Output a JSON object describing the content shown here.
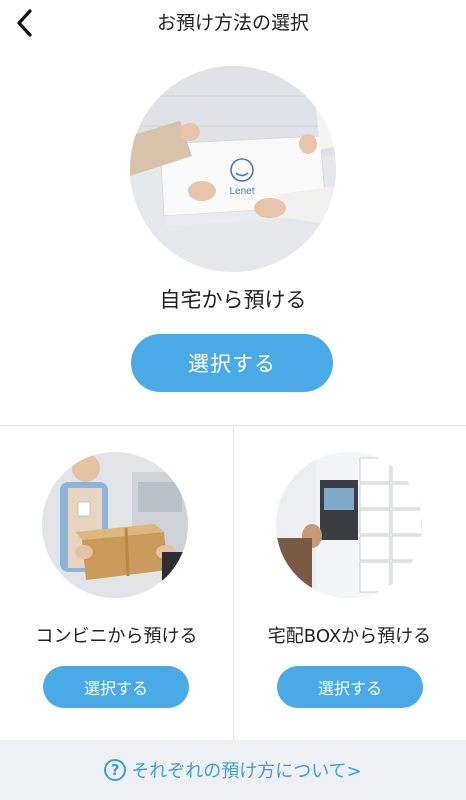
{
  "header": {
    "title": "お預け方法の選択",
    "back_icon": "chevron-left-icon"
  },
  "home": {
    "label": "自宅から預ける",
    "button": "選択する",
    "box_logo": "Lenet"
  },
  "convenience": {
    "label": "コンビニから預ける",
    "button": "選択する"
  },
  "delivery_box": {
    "label": "宅配BOXから預ける",
    "button": "選択する"
  },
  "footer": {
    "link": "それぞれの預け方について>",
    "icon": "help-circle-icon"
  },
  "colors": {
    "accent": "#4aaae6",
    "link": "#3e9fd9",
    "footer_bg": "#eef0f4"
  }
}
